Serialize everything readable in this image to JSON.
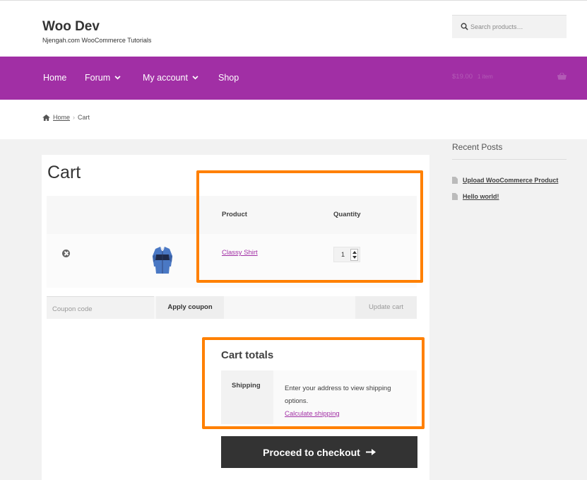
{
  "site": {
    "title": "Woo Dev",
    "tagline": "Njengah.com WooCommerce Tutorials",
    "search_placeholder": "Search products…"
  },
  "nav": {
    "items": [
      {
        "label": "Home",
        "dropdown": false
      },
      {
        "label": "Forum",
        "dropdown": true
      },
      {
        "label": "My account",
        "dropdown": true
      },
      {
        "label": "Shop",
        "dropdown": false
      }
    ],
    "cart_amount": "$19.00",
    "cart_count": "1 item"
  },
  "breadcrumb": {
    "home": "Home",
    "current": "Cart"
  },
  "page": {
    "title": "Cart"
  },
  "cart": {
    "columns": {
      "product": "Product",
      "quantity": "Quantity"
    },
    "items": [
      {
        "name": "Classy Shirt",
        "quantity": "1"
      }
    ],
    "coupon_placeholder": "Coupon code",
    "apply_coupon_label": "Apply coupon",
    "update_cart_label": "Update cart"
  },
  "totals": {
    "title": "Cart totals",
    "shipping_label": "Shipping",
    "shipping_text": "Enter your address to view shipping options.",
    "calculate_shipping_label": "Calculate shipping"
  },
  "checkout": {
    "label": "Proceed to checkout"
  },
  "sidebar": {
    "widget_title": "Recent Posts",
    "posts": [
      "Upload WooCommerce Product",
      "Hello world!"
    ]
  },
  "colors": {
    "brand": "#a12fa5",
    "highlight": "#ff8000",
    "checkout_button": "#333333"
  }
}
